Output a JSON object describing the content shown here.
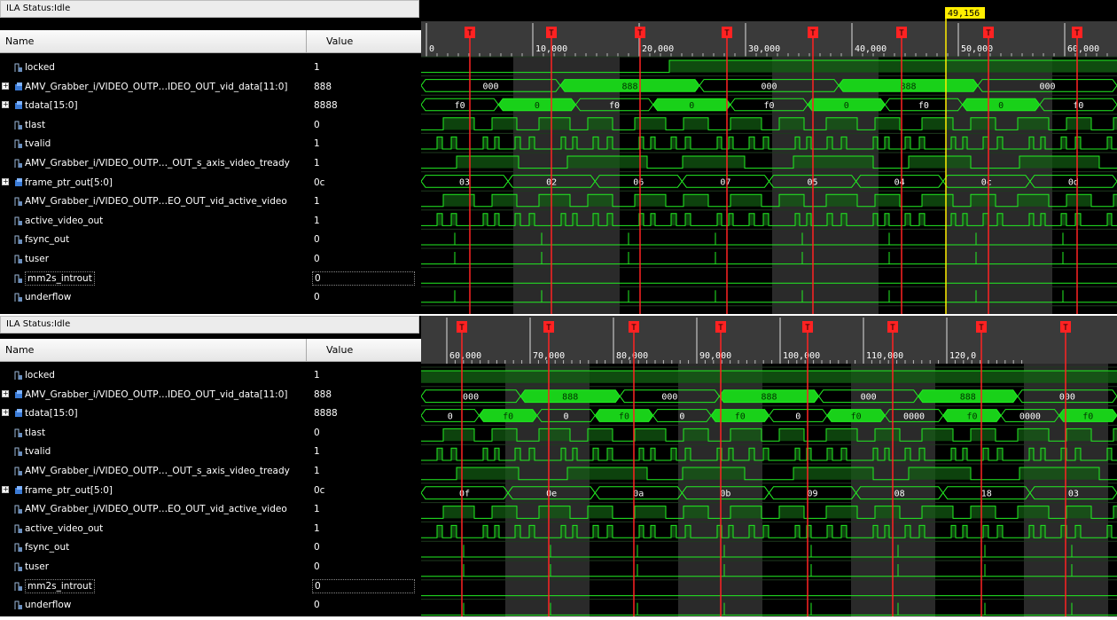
{
  "panels": [
    {
      "status": "ILA Status:Idle",
      "col_name": "Name",
      "col_value": "Value",
      "cursor_label": "49,156",
      "ticks": [
        "0",
        "10,000",
        "20,000",
        "30,000",
        "40,000",
        "50,000",
        "60,000"
      ],
      "signals": [
        {
          "name": "locked",
          "value": "1",
          "bus": false
        },
        {
          "name": "AMV_Grabber_i/VIDEO_OUTP…IDEO_OUT_vid_data[11:0]",
          "value": "888",
          "bus": true
        },
        {
          "name": "tdata[15:0]",
          "value": "8888",
          "bus": true
        },
        {
          "name": "tlast",
          "value": "0",
          "bus": false
        },
        {
          "name": "tvalid",
          "value": "1",
          "bus": false
        },
        {
          "name": "AMV_Grabber_i/VIDEO_OUTP…_OUT_s_axis_video_tready",
          "value": "1",
          "bus": false
        },
        {
          "name": "frame_ptr_out[5:0]",
          "value": "0c",
          "bus": true
        },
        {
          "name": "AMV_Grabber_i/VIDEO_OUTP…EO_OUT_vid_active_video",
          "value": "1",
          "bus": false
        },
        {
          "name": "active_video_out",
          "value": "1",
          "bus": false
        },
        {
          "name": "fsync_out",
          "value": "0",
          "bus": false
        },
        {
          "name": "tuser",
          "value": "0",
          "bus": false
        },
        {
          "name": "mm2s_introut",
          "value": "0",
          "bus": false
        },
        {
          "name": "underflow",
          "value": "0",
          "bus": false
        }
      ],
      "bus_labels": {
        "vid_data": [
          "000",
          "888",
          "000",
          "888",
          "000"
        ],
        "tdata": [
          "f0",
          "0",
          "f0",
          "0",
          "f0",
          "0",
          "f0",
          "0",
          "f0"
        ],
        "frame_ptr": [
          "03",
          "02",
          "06",
          "07",
          "05",
          "04",
          "0c",
          "0d"
        ]
      }
    },
    {
      "status": "ILA Status:Idle",
      "col_name": "Name",
      "col_value": "Value",
      "ticks": [
        "60,000",
        "70,000",
        "80,000",
        "90,000",
        "100,000",
        "110,000",
        "120,0"
      ],
      "signals": [
        {
          "name": "locked",
          "value": "1",
          "bus": false
        },
        {
          "name": "AMV_Grabber_i/VIDEO_OUTP…IDEO_OUT_vid_data[11:0]",
          "value": "888",
          "bus": true
        },
        {
          "name": "tdata[15:0]",
          "value": "8888",
          "bus": true
        },
        {
          "name": "tlast",
          "value": "0",
          "bus": false
        },
        {
          "name": "tvalid",
          "value": "1",
          "bus": false
        },
        {
          "name": "AMV_Grabber_i/VIDEO_OUTP…_OUT_s_axis_video_tready",
          "value": "1",
          "bus": false
        },
        {
          "name": "frame_ptr_out[5:0]",
          "value": "0c",
          "bus": true
        },
        {
          "name": "AMV_Grabber_i/VIDEO_OUTP…EO_OUT_vid_active_video",
          "value": "1",
          "bus": false
        },
        {
          "name": "active_video_out",
          "value": "1",
          "bus": false
        },
        {
          "name": "fsync_out",
          "value": "0",
          "bus": false
        },
        {
          "name": "tuser",
          "value": "0",
          "bus": false
        },
        {
          "name": "mm2s_introut",
          "value": "0",
          "bus": false
        },
        {
          "name": "underflow",
          "value": "0",
          "bus": false
        }
      ],
      "bus_labels": {
        "vid_data": [
          "000",
          "888",
          "000",
          "888",
          "000",
          "888",
          "000"
        ],
        "tdata": [
          "0",
          "f0",
          "0",
          "f0",
          "0",
          "f0",
          "0",
          "f0",
          "0000",
          "f0",
          "0000",
          "f0"
        ],
        "frame_ptr": [
          "0f",
          "0e",
          "0a",
          "0b",
          "09",
          "08",
          "18",
          "03"
        ]
      }
    }
  ],
  "trigger_marker": "T",
  "colors": {
    "wave": "#22ee22",
    "bus_fill": "#19d119",
    "trigger": "#ff2222",
    "cursor": "#ffee00"
  }
}
